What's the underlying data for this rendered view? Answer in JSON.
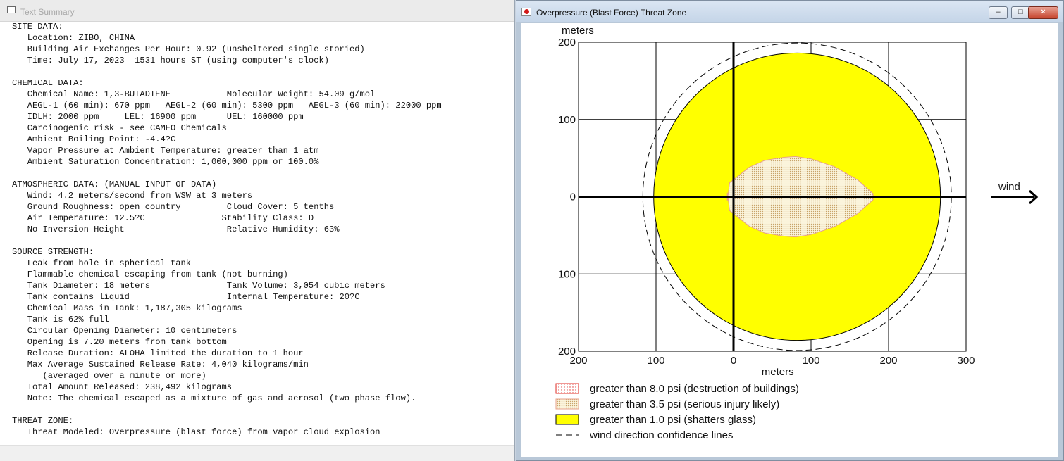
{
  "left_window": {
    "title": "Text Summary",
    "lines": [
      "SITE DATA:",
      "   Location: ZIBO, CHINA",
      "   Building Air Exchanges Per Hour: 0.92 (unsheltered single storied)",
      "   Time: July 17, 2023  1531 hours ST (using computer's clock)",
      "",
      "CHEMICAL DATA:",
      "   Chemical Name: 1,3-BUTADIENE           Molecular Weight: 54.09 g/mol",
      "   AEGL-1 (60 min): 670 ppm   AEGL-2 (60 min): 5300 ppm   AEGL-3 (60 min): 22000 ppm",
      "   IDLH: 2000 ppm     LEL: 16900 ppm      UEL: 160000 ppm",
      "   Carcinogenic risk - see CAMEO Chemicals",
      "   Ambient Boiling Point: -4.4?C",
      "   Vapor Pressure at Ambient Temperature: greater than 1 atm",
      "   Ambient Saturation Concentration: 1,000,000 ppm or 100.0%",
      "",
      "ATMOSPHERIC DATA: (MANUAL INPUT OF DATA)",
      "   Wind: 4.2 meters/second from WSW at 3 meters",
      "   Ground Roughness: open country         Cloud Cover: 5 tenths",
      "   Air Temperature: 12.5?C               Stability Class: D",
      "   No Inversion Height                    Relative Humidity: 63%",
      "",
      "SOURCE STRENGTH:",
      "   Leak from hole in spherical tank",
      "   Flammable chemical escaping from tank (not burning)",
      "   Tank Diameter: 18 meters               Tank Volume: 3,054 cubic meters",
      "   Tank contains liquid                   Internal Temperature: 20?C",
      "   Chemical Mass in Tank: 1,187,305 kilograms",
      "   Tank is 62% full",
      "   Circular Opening Diameter: 10 centimeters",
      "   Opening is 7.20 meters from tank bottom",
      "   Release Duration: ALOHA limited the duration to 1 hour",
      "   Max Average Sustained Release Rate: 4,040 kilograms/min",
      "      (averaged over a minute or more)",
      "   Total Amount Released: 238,492 kilograms",
      "   Note: The chemical escaped as a mixture of gas and aerosol (two phase flow).",
      "",
      "THREAT ZONE:",
      "   Threat Modeled: Overpressure (blast force) from vapor cloud explosion"
    ]
  },
  "right_window": {
    "title": "Overpressure (Blast Force) Threat Zone",
    "buttons": {
      "minimize": "–",
      "maximize": "□",
      "close": "×"
    }
  },
  "chart_data": {
    "type": "area",
    "title": "",
    "ylabel": "meters",
    "xlabel": "meters",
    "x_ticks": [
      "200",
      "100",
      "0",
      "100",
      "200",
      "300"
    ],
    "y_ticks": [
      "200",
      "100",
      "0",
      "100",
      "200"
    ],
    "xlim": [
      -200,
      300
    ],
    "ylim": [
      -200,
      200
    ],
    "grid": true,
    "wind_label": "wind",
    "zones": [
      {
        "name": "greater than 1.0 psi (shatters glass)",
        "color": "#ffff00",
        "center": [
          82,
          0
        ],
        "radius_x": 185,
        "radius_y": 186
      },
      {
        "name": "greater than 3.5 psi (serious injury likely)",
        "color": "#f2e6c0",
        "outline": [
          [
            -8,
            -5
          ],
          [
            -5,
            18
          ],
          [
            20,
            38
          ],
          [
            40,
            47
          ],
          [
            65,
            51
          ],
          [
            80,
            52
          ],
          [
            100,
            49
          ],
          [
            130,
            39
          ],
          [
            160,
            22
          ],
          [
            180,
            4
          ],
          [
            180,
            -4
          ],
          [
            160,
            -22
          ],
          [
            130,
            -39
          ],
          [
            100,
            -49
          ],
          [
            80,
            -52
          ],
          [
            65,
            -51
          ],
          [
            40,
            -47
          ],
          [
            20,
            -38
          ],
          [
            -5,
            -18
          ],
          [
            -8,
            5
          ]
        ]
      }
    ],
    "confidence_lines": {
      "center": [
        82,
        0
      ],
      "radius_x": 199,
      "radius_y": 199
    },
    "legend": [
      {
        "label": "greater than 8.0 psi (destruction of buildings)",
        "style": "red-dotted"
      },
      {
        "label": "greater than 3.5 psi (serious injury likely)",
        "style": "tan-dotted"
      },
      {
        "label": "greater than 1.0 psi (shatters glass)",
        "style": "yellow-solid"
      },
      {
        "label": "wind direction confidence lines",
        "style": "dashed"
      }
    ]
  }
}
